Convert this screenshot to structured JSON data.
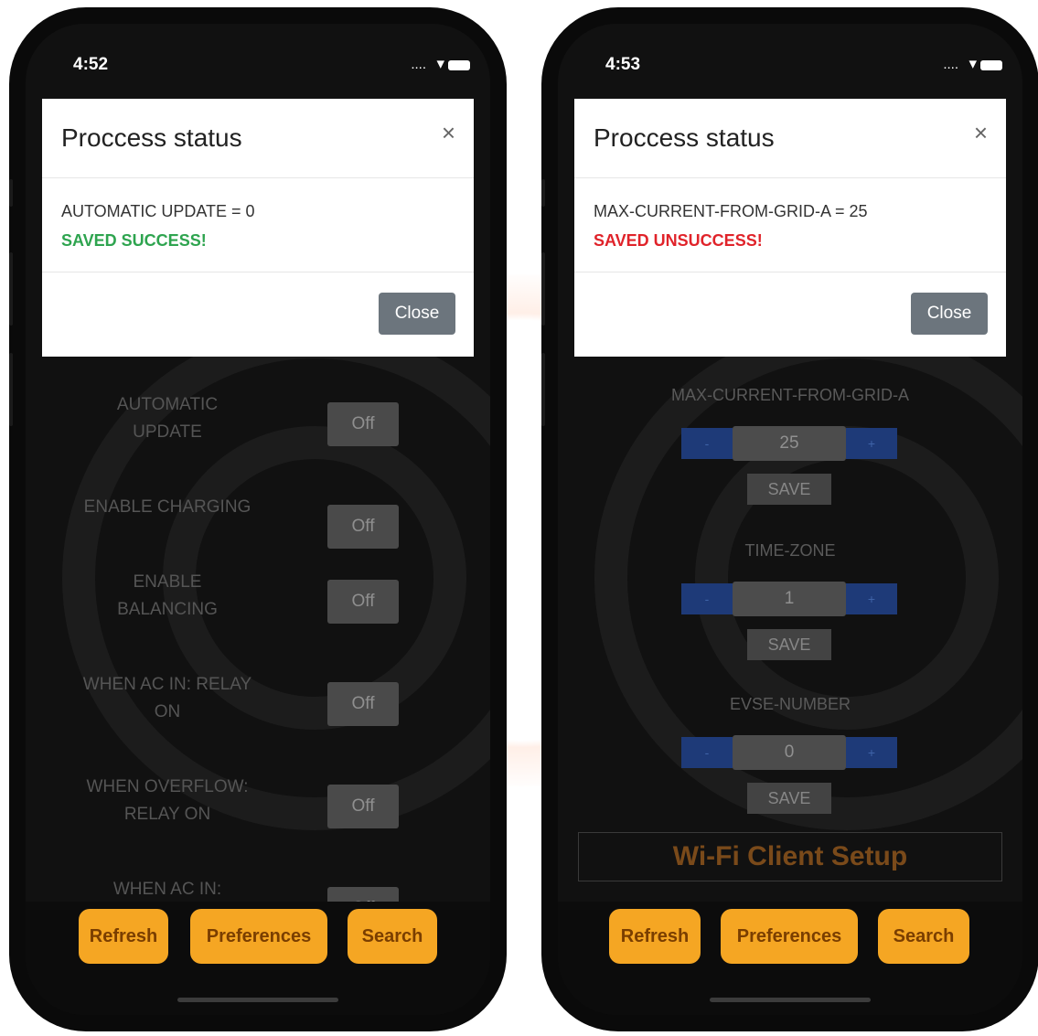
{
  "left": {
    "status": {
      "time": "4:52",
      "signal": "...."
    },
    "modal": {
      "title": "Proccess status",
      "close_x": "×",
      "message": "AUTOMATIC UPDATE = 0",
      "result": "SAVED SUCCESS!",
      "result_color": "#2ea44f",
      "close_label": "Close"
    },
    "settings": [
      {
        "label_line1": "AUTOMATIC",
        "label_line2": "UPDATE",
        "value": "Off"
      },
      {
        "label_line1": "ENABLE CHARGING",
        "label_line2": "",
        "value": "Off"
      },
      {
        "label_line1": "ENABLE",
        "label_line2": "BALANCING",
        "value": "Off"
      },
      {
        "label_line1": "WHEN AC IN: RELAY",
        "label_line2": "ON",
        "value": "Off"
      },
      {
        "label_line1": "WHEN OVERFLOW:",
        "label_line2": "RELAY ON",
        "value": "Off"
      },
      {
        "label_line1": "WHEN AC IN:",
        "label_line2": "",
        "value": "Off"
      }
    ],
    "buttons": {
      "refresh": "Refresh",
      "preferences": "Preferences",
      "search": "Search"
    }
  },
  "right": {
    "status": {
      "time": "4:53",
      "signal": "...."
    },
    "modal": {
      "title": "Proccess status",
      "close_x": "×",
      "message": "MAX-CURRENT-FROM-GRID-A = 25",
      "result": "SAVED UNSUCCESS!",
      "result_color": "#e0232a",
      "close_label": "Close"
    },
    "fields": [
      {
        "label": "MAX-CURRENT-FROM-GRID-A",
        "value": "25",
        "minus": "-",
        "plus": "+",
        "save": "SAVE"
      },
      {
        "label": "TIME-ZONE",
        "value": "1",
        "minus": "-",
        "plus": "+",
        "save": "SAVE"
      },
      {
        "label": "EVSE-NUMBER",
        "value": "0",
        "minus": "-",
        "plus": "+",
        "save": "SAVE"
      }
    ],
    "wifi_setup": "Wi-Fi Client Setup",
    "buttons": {
      "refresh": "Refresh",
      "preferences": "Preferences",
      "search": "Search"
    }
  },
  "colors": {
    "accent": "#f5a623",
    "stepper_blue": "#1e3a78",
    "success": "#2ea44f",
    "error": "#e0232a"
  }
}
